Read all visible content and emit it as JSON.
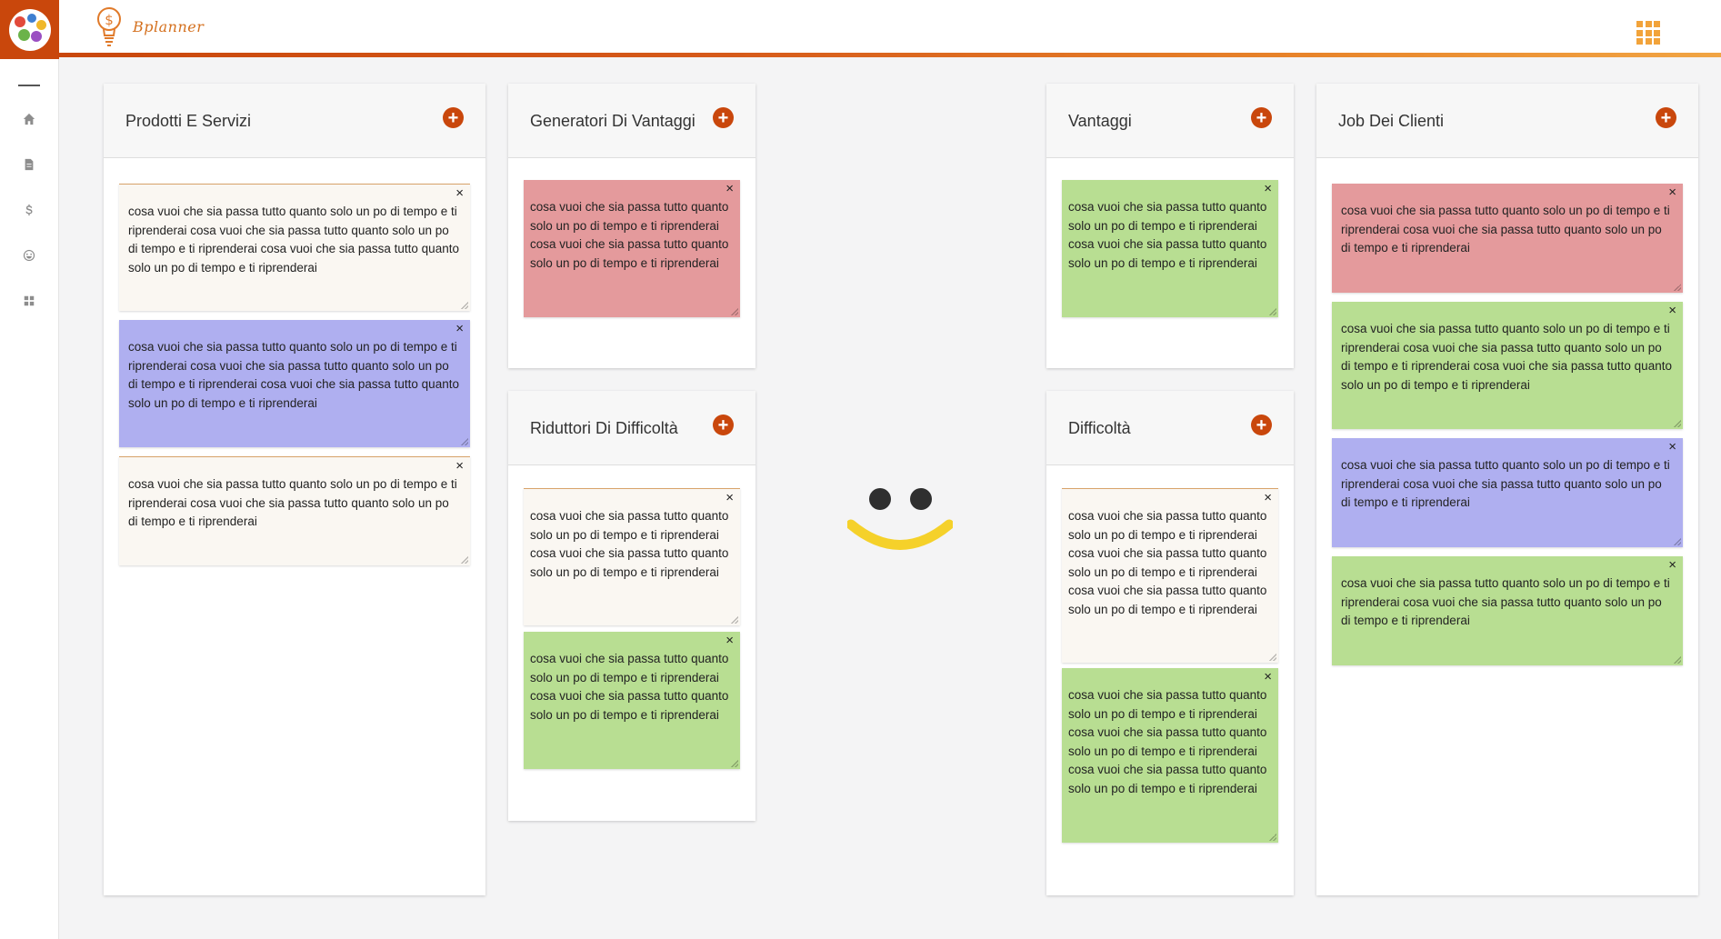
{
  "app": {
    "brand_name": "Bplanner"
  },
  "sidebar": {
    "icons": [
      "home-icon",
      "document-icon",
      "dollar-icon",
      "smiley-icon",
      "grid-icon"
    ]
  },
  "header": {
    "apps_icon": "apps-grid-icon"
  },
  "colors": {
    "accent": "#c9470c",
    "note_cream": "#faf7f2",
    "note_pink": "#e49a9c",
    "note_green": "#b8de92",
    "note_purple": "#afaff0",
    "smiley": "#f5d12a"
  },
  "columns": {
    "prodotti": {
      "title": "Prodotti E Servizi",
      "notes": [
        "cosa vuoi che sia passa tutto quanto solo un po di tempo e ti riprenderai cosa vuoi che sia passa tutto quanto solo un po di tempo e ti riprenderai cosa vuoi che sia passa tutto quanto solo un po di tempo e ti riprenderai",
        "cosa vuoi che sia passa tutto quanto solo un po di tempo e ti riprenderai cosa vuoi che sia passa tutto quanto solo un po di tempo e ti riprenderai cosa vuoi che sia passa tutto quanto solo un po di tempo e ti riprenderai",
        "cosa vuoi che sia passa tutto quanto solo un po di tempo e ti riprenderai cosa vuoi che sia passa tutto quanto solo un po di tempo e ti riprenderai"
      ]
    },
    "generatori": {
      "title": "Generatori Di Vantaggi",
      "notes": [
        "cosa vuoi che sia passa tutto quanto solo un po di tempo e ti riprenderai cosa vuoi che sia passa tutto quanto solo un po di tempo e ti riprenderai"
      ]
    },
    "riduttori": {
      "title": "Riduttori Di Difficoltà",
      "notes": [
        "cosa vuoi che sia passa tutto quanto solo un po di tempo e ti riprenderai cosa vuoi che sia passa tutto quanto solo un po di tempo e ti riprenderai",
        "cosa vuoi che sia passa tutto quanto solo un po di tempo e ti riprenderai cosa vuoi che sia passa tutto quanto solo un po di tempo e ti riprenderai"
      ]
    },
    "vantaggi": {
      "title": "Vantaggi",
      "notes": [
        "cosa vuoi che sia passa tutto quanto solo un po di tempo e ti riprenderai cosa vuoi che sia passa tutto quanto solo un po di tempo e ti riprenderai"
      ]
    },
    "difficolta": {
      "title": "Difficoltà",
      "notes": [
        "cosa vuoi che sia passa tutto quanto solo un po di tempo e ti riprenderai cosa vuoi che sia passa tutto quanto solo un po di tempo e ti riprenderai cosa vuoi che sia passa tutto quanto solo un po di tempo e ti riprenderai",
        "cosa vuoi che sia passa tutto quanto solo un po di tempo e ti riprenderai cosa vuoi che sia passa tutto quanto solo un po di tempo e ti riprenderai cosa vuoi che sia passa tutto quanto solo un po di tempo e ti riprenderai"
      ]
    },
    "job": {
      "title": "Job Dei Clienti",
      "notes": [
        "cosa vuoi che sia passa tutto quanto solo un po di tempo e ti riprenderai cosa vuoi che sia passa tutto quanto solo un po di tempo e ti riprenderai",
        "cosa vuoi che sia passa tutto quanto solo un po di tempo e ti riprenderai cosa vuoi che sia passa tutto quanto solo un po di tempo e ti riprenderai cosa vuoi che sia passa tutto quanto solo un po di tempo e ti riprenderai",
        "cosa vuoi che sia passa tutto quanto solo un po di tempo e ti riprenderai cosa vuoi che sia passa tutto quanto solo un po di tempo e ti riprenderai",
        "cosa vuoi che sia passa tutto quanto solo un po di tempo e ti riprenderai cosa vuoi che sia passa tutto quanto solo un po di tempo e ti riprenderai"
      ]
    }
  },
  "add_symbol": "+",
  "close_symbol": "×"
}
